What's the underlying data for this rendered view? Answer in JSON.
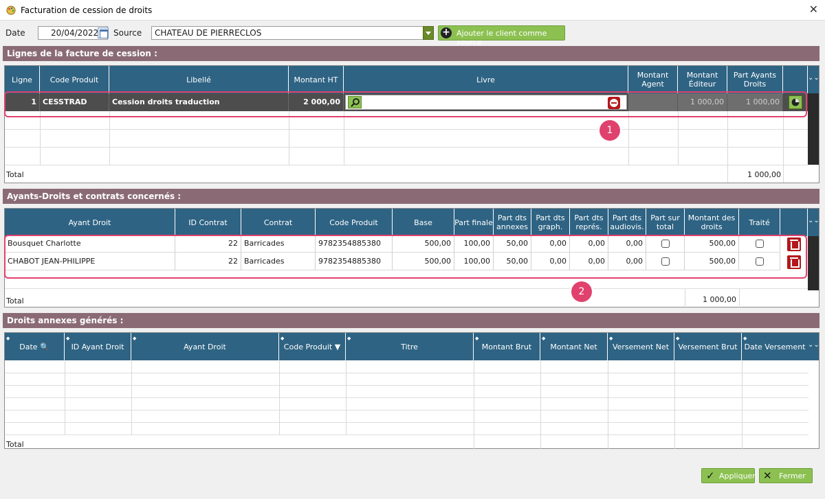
{
  "window": {
    "title": "Facturation de cession de droits",
    "close_glyph": "✕",
    "app_icon": "palette-icon"
  },
  "topbar": {
    "date_label": "Date",
    "date_value": "20/04/2022",
    "source_label": "Source",
    "source_value": "CHATEAU DE PIERRECLOS",
    "add_source_button": "Ajouter le client comme source"
  },
  "sections": {
    "lines": "Lignes de la facture de cession :",
    "rights": "Ayants-Droits et contrats concernés :",
    "annex": "Droits annexes générés :"
  },
  "lines_table": {
    "columns": [
      "Ligne",
      "Code Produit",
      "Libellé",
      "Montant HT",
      "Livre",
      "Montant Agent",
      "Montant Éditeur",
      "Part Ayants Droits"
    ],
    "row": {
      "ligne": "1",
      "code": "CESSTRAD",
      "libelle": "Cession droits traduction",
      "montant_ht": "2 000,00",
      "livre": "",
      "agent": "",
      "editeur": "1 000,00",
      "part": "1 000,00"
    },
    "total_label": "Total",
    "total_value": "1 000,00"
  },
  "rights_table": {
    "columns": [
      "Ayant Droit",
      "ID Contrat",
      "Contrat",
      "Code Produit",
      "Base",
      "Part finale",
      "Part dts annexes",
      "Part dts graph.",
      "Part dts représ.",
      "Part dts audiovis.",
      "Part sur total",
      "Montant des droits",
      "Traité"
    ],
    "rows": [
      {
        "ayant": "Bousquet Charlotte",
        "id": "22",
        "contrat": "Barricades",
        "code": "9782354885380",
        "base": "500,00",
        "finale": "100,00",
        "annexes": "50,00",
        "graph": "0,00",
        "repres": "0,00",
        "audio": "0,00",
        "montant": "500,00"
      },
      {
        "ayant": "CHABOT JEAN-PHILIPPE",
        "id": "22",
        "contrat": "Barricades",
        "code": "9782354885380",
        "base": "500,00",
        "finale": "100,00",
        "annexes": "50,00",
        "graph": "0,00",
        "repres": "0,00",
        "audio": "0,00",
        "montant": "500,00"
      }
    ],
    "total_label": "Total",
    "total_value": "1 000,00"
  },
  "annex_table": {
    "columns": [
      "Date",
      "ID Ayant Droit",
      "Ayant Droit",
      "Code Produit",
      "Titre",
      "Montant Brut",
      "Montant Net",
      "Versement Net",
      "Versement Brut",
      "Date Versement"
    ],
    "total_label": "Total"
  },
  "annotations": {
    "one": "1",
    "two": "2"
  },
  "footer": {
    "apply": "Appliquer",
    "close": "Fermer"
  },
  "colors": {
    "header_blue": "#2e6383",
    "section_mauve": "#8a6b75",
    "green": "#8cc152",
    "annotation_pink": "#e0416d",
    "delete_red": "#b3171b"
  }
}
